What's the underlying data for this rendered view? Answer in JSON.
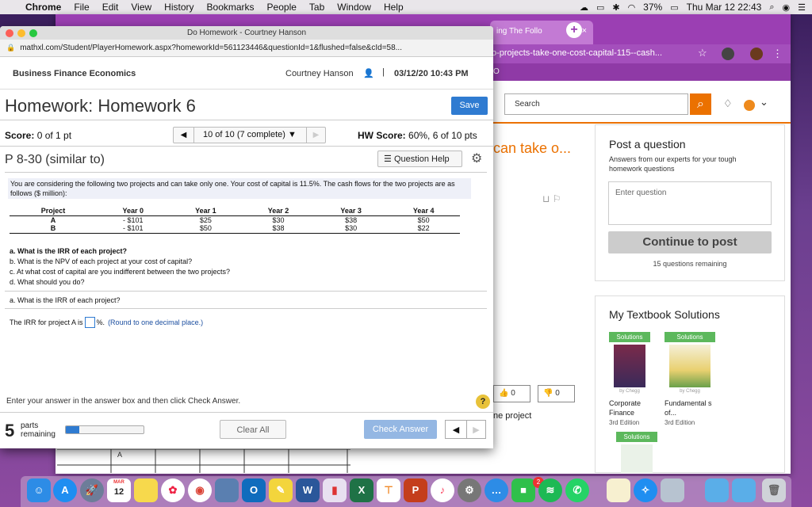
{
  "menubar": {
    "app": "Chrome",
    "items": [
      "File",
      "Edit",
      "View",
      "History",
      "Bookmarks",
      "People",
      "Tab",
      "Window",
      "Help"
    ],
    "battery": "37%",
    "datetime": "Thu Mar 12  22:43"
  },
  "bg_window": {
    "tab_label": "ing The Follo",
    "url_fragment": "o-projects-take-one-cost-capital-115--cash...",
    "bookmark_fragment": "O",
    "search_placeholder": "Search",
    "question_title_fragment": "can take o...",
    "like_count": "0",
    "dislike_count": "0",
    "project_fragment": "ne project",
    "post": {
      "title": "Post a question",
      "subtitle": "Answers from our experts for your tough homework questions",
      "input_placeholder": "Enter question",
      "button": "Continue to post",
      "remaining": "15 questions remaining"
    },
    "textbooks": {
      "title": "My Textbook Solutions",
      "items": [
        {
          "tag": "Solutions",
          "brand": "by Chegg",
          "name": "Corporate Finance",
          "edition": "3rd Edition"
        },
        {
          "tag": "Solutions",
          "brand": "by Chegg",
          "name": "Fundamental s of...",
          "edition": "3rd Edition"
        },
        {
          "tag": "Solutions"
        }
      ]
    },
    "grid_letter": "A"
  },
  "front_window": {
    "title": "Do Homework - Courtney Hanson",
    "url": "mathxl.com/Student/PlayerHomework.aspx?homeworkId=561123446&questionId=1&flushed=false&cId=58...",
    "course": "Business Finance Economics",
    "user": "Courtney Hanson",
    "separator": "|",
    "date": "03/12/20 10:43 PM",
    "homework_title": "Homework: Homework 6",
    "save_label": "Save",
    "score_label": "Score:",
    "score_value": "0 of 1 pt",
    "question_position": "10 of 10 (7 complete)",
    "hw_score_label": "HW Score:",
    "hw_score_value": "60%, 6 of 10 pts",
    "question_id": "P 8-30 (similar to)",
    "question_help": "Question Help",
    "question_text": "You are considering the following two projects and can take only one. Your cost of capital is 11.5%. The cash flows for the two projects are as follows ($ million):",
    "table": {
      "headers": [
        "Project",
        "Year 0",
        "Year 1",
        "Year 2",
        "Year 3",
        "Year 4"
      ],
      "rows": [
        [
          "A",
          "- $101",
          "$25",
          "$30",
          "$38",
          "$50"
        ],
        [
          "B",
          "- $101",
          "$50",
          "$38",
          "$30",
          "$22"
        ]
      ]
    },
    "subquestions": [
      "a. What is the IRR of each project?",
      "b. What is the NPV of each project at your cost of capital?",
      "c. At what cost of capital are you indifferent between the two projects?",
      "d. What should you do?"
    ],
    "current_part": "a. What is the IRR of each project?",
    "irr_prefix": "The IRR for project A is",
    "irr_suffix": "%.",
    "irr_hint": "(Round to one decimal place.)",
    "instruction": "Enter your answer in the answer box and then click Check Answer.",
    "help_symbol": "?",
    "parts_count": "5",
    "parts_label_1": "parts",
    "parts_label_2": "remaining",
    "progress_fraction": 0.17,
    "clear_all": "Clear All",
    "check_answer": "Check Answer"
  },
  "dock": {
    "calendar_month": "MAR",
    "calendar_day": "12",
    "notification_badge": "2"
  }
}
